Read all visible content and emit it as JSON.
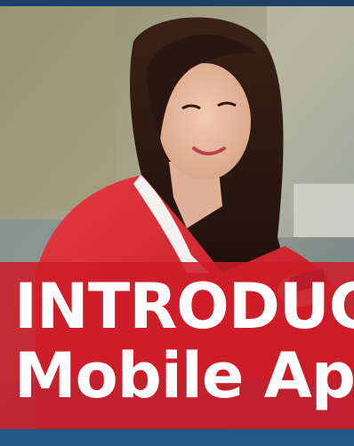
{
  "hero": {
    "photo_icon": "woman-with-smartphone-photo",
    "headline_line1": "INTRODUC",
    "headline_line2": "Mobile App",
    "banner_color": "#cd1c28",
    "text_color": "#ffffff"
  }
}
